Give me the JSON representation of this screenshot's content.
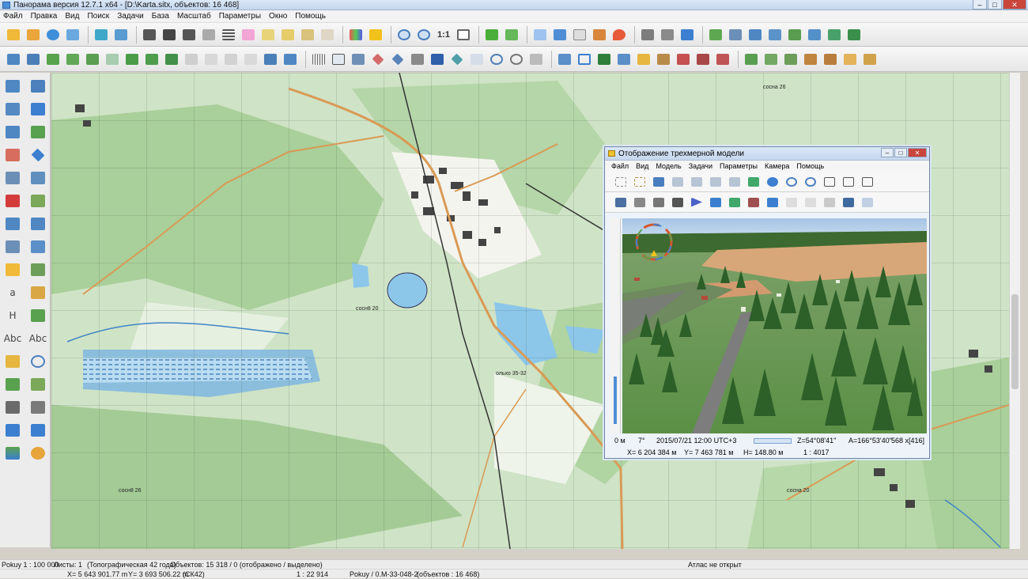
{
  "window": {
    "title": "Панорама версия 12.7.1 x64 - [D:\\Karta.sitx, объектов: 16 468]",
    "controls": [
      "–",
      "□",
      "✕"
    ]
  },
  "menu": [
    "Файл",
    "Правка",
    "Вид",
    "Поиск",
    "Задачи",
    "База",
    "Масштаб",
    "Параметры",
    "Окно",
    "Помощь"
  ],
  "toolbar": {
    "zoom_label": "1:1"
  },
  "left_tools": {
    "letter_a": "a",
    "letter_h": "H",
    "abc_1": "Abc",
    "abc_2": "Abc"
  },
  "map_labels": {
    "label1": "сосн8 20",
    "label2": "сосн8 26",
    "label3": "сосна 20",
    "label4": "сосна 26",
    "label5": "сосн8 20",
    "label6": "сосн8 20",
    "label7": "ольхо 35-32"
  },
  "model_window": {
    "title": "Отображение трехмерной модели",
    "controls": [
      "–",
      "□",
      "✕"
    ],
    "menu": [
      "Файл",
      "Вид",
      "Модель",
      "Задачи",
      "Параметры",
      "Камера",
      "Помощь"
    ],
    "status": {
      "height": "0 м",
      "angle": "7°",
      "datetime": "2015/07/21  12:00  UTC+3",
      "z": "Z=54°08'41\"",
      "a": "A=166°53'40\"",
      "size": "568 x[416]",
      "x": "X= 6 204 384 м",
      "y": "Y= 7 463 781 м",
      "h": "H= 148.80 м",
      "scale": "1 : 4017"
    }
  },
  "statusbar": {
    "scale": "Pokuy 1 : 100 000",
    "sheets": "Листы: 1",
    "map_type": "(Топографическая 42 года)",
    "objects": "Объектов: 15 318 / 0 (отображено / выделено)",
    "atlas": "Атлас не открыт",
    "x": "X= 5 643 901.77 m",
    "y": "Y= 3 693 506.22 m",
    "sk": "(СК42)",
    "view_scale": "1 : 22 914",
    "sheet_name": "Pokuy / 0.M-33-048-2",
    "sheet_objects": "(объектов : 16 468)"
  },
  "colors": {
    "map_background": "#cfe3c6",
    "forest": "#a9cf9a",
    "road": "#d99a55",
    "water": "#8cc7ea",
    "grid": "#3c4a40"
  }
}
